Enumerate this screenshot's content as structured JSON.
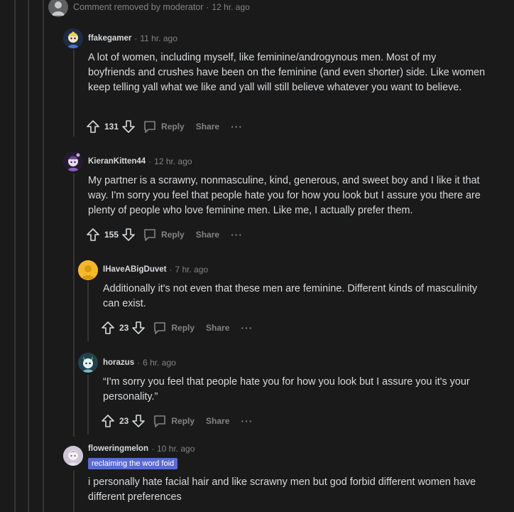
{
  "removed": {
    "text": "Comment removed by moderator",
    "time": "12 hr. ago"
  },
  "comments": [
    {
      "username": "ffakegamer",
      "time": "11 hr. ago",
      "body": "A lot of women, including myself, like feminine/androgynous men. Most of my boyfriends and crushes have been on the feminine (and even shorter) side. Like women keep telling yall what we like and yall will still believe whatever you want to believe.",
      "votes": "131",
      "reply_label": "Reply",
      "share_label": "Share"
    },
    {
      "username": "KieranKitten44",
      "time": "12 hr. ago",
      "body": "My partner is a scrawny, nonmasculine, kind, generous, and sweet boy and I like it that way. I'm sorry you feel that people hate you for how you look but I assure you there are plenty of people who love feminine men. Like me, I actually prefer them.",
      "votes": "155",
      "reply_label": "Reply",
      "share_label": "Share"
    },
    {
      "username": "IHaveABigDuvet",
      "time": "7 hr. ago",
      "body": "Additionally it's not even that these men are feminine. Different kinds of masculinity can exist.",
      "votes": "23",
      "reply_label": "Reply",
      "share_label": "Share"
    },
    {
      "username": "horazus",
      "time": "6 hr. ago",
      "body": "“I'm sorry you feel that people hate you for how you look but I assure you it's your personality.”",
      "votes": "23",
      "reply_label": "Reply",
      "share_label": "Share"
    },
    {
      "username": "floweringmelon",
      "time": "10 hr. ago",
      "flair": "reclaiming the word foid",
      "body": "i personally hate facial hair and like scrawny men but god forbid different women have different preferences"
    }
  ],
  "colors": {
    "background": "#1a1a1b",
    "text": "#d7dadc",
    "muted": "#818384",
    "thread_line": "#343536",
    "flair_bg": "#5b6bd0"
  }
}
